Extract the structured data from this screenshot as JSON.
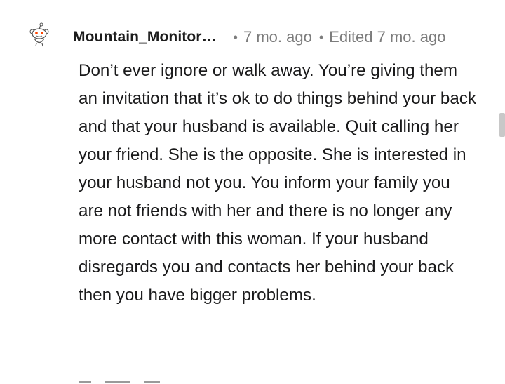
{
  "comment": {
    "author": "Mountain_Monitor…",
    "age": "7 mo. ago",
    "edited": "Edited 7 mo. ago",
    "separator": "•",
    "body": "Don’t ever ignore or walk away. You’re giving them an invitation that it’s ok to do things behind your back and that your husband is available. Quit calling her your friend. She is the opposite. She is interested in your husband not you. You inform your family you are not friends with her and there is no longer any more contact with this woman. If your husband disregards you and contacts her behind your back then you have bigger problems.",
    "avatar_icon": "snoo-avatar-icon"
  },
  "colors": {
    "text": "#1a1a1b",
    "meta": "#7c7c7c",
    "accent": "#ff4500"
  }
}
